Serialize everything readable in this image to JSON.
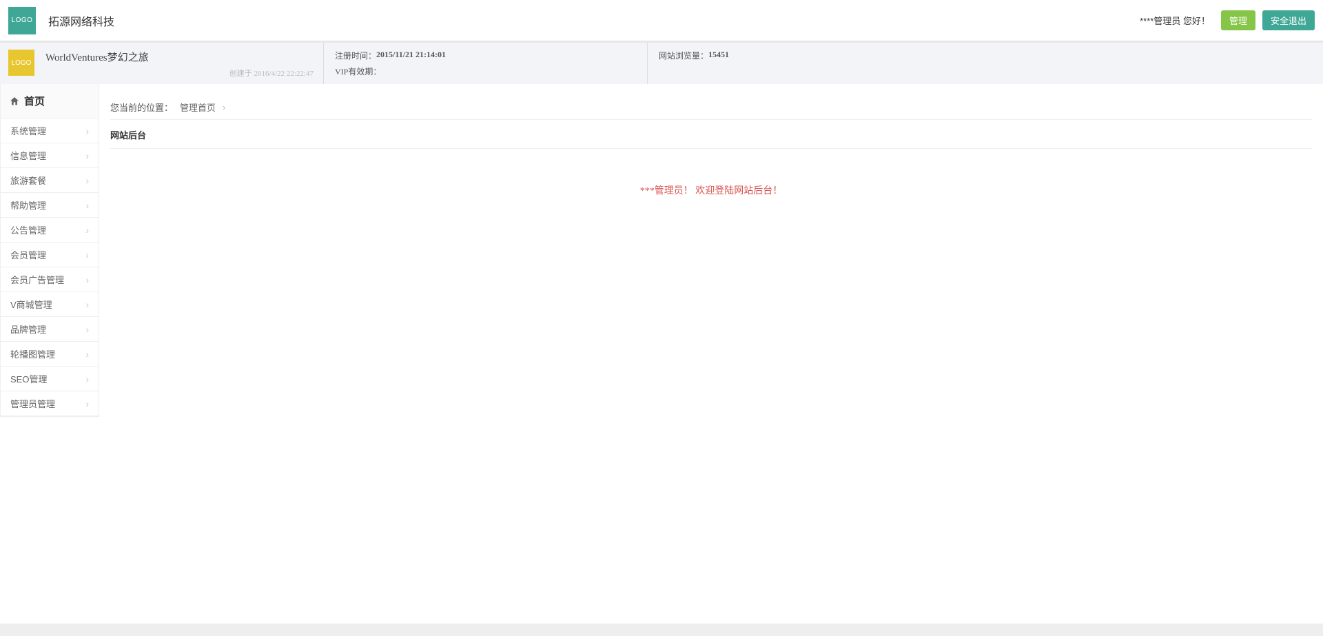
{
  "header": {
    "logo_text": "LOGO",
    "company_name": "拓源网络科技",
    "greeting": "****管理员 您好！",
    "manage_btn": "管理",
    "logout_btn": "安全退出"
  },
  "infobar": {
    "logo_text": "LOGO",
    "site_name": "WorldVentures梦幻之旅",
    "created_label": "创建于",
    "created_value": "2016/4/22 22:22:47",
    "register_label": "注册时间：",
    "register_value": "2015/11/21 21:14:01",
    "vip_label": "VIP有效期：",
    "vip_value": "",
    "views_label": "网站浏览量：",
    "views_value": "15451"
  },
  "sidebar": {
    "home": "首页",
    "items": [
      {
        "label": "系统管理"
      },
      {
        "label": "信息管理"
      },
      {
        "label": "旅游套餐"
      },
      {
        "label": "帮助管理"
      },
      {
        "label": "公告管理"
      },
      {
        "label": "会员管理"
      },
      {
        "label": "会员广告管理"
      },
      {
        "label": "V商城管理"
      },
      {
        "label": "品牌管理"
      },
      {
        "label": "轮播图管理"
      },
      {
        "label": "SEO管理"
      },
      {
        "label": "管理员管理"
      }
    ]
  },
  "breadcrumb": {
    "location_label": "您当前的位置：",
    "current": "管理首页"
  },
  "content": {
    "section_title": "网站后台",
    "welcome": "***管理员！  欢迎登陆网站后台！"
  }
}
